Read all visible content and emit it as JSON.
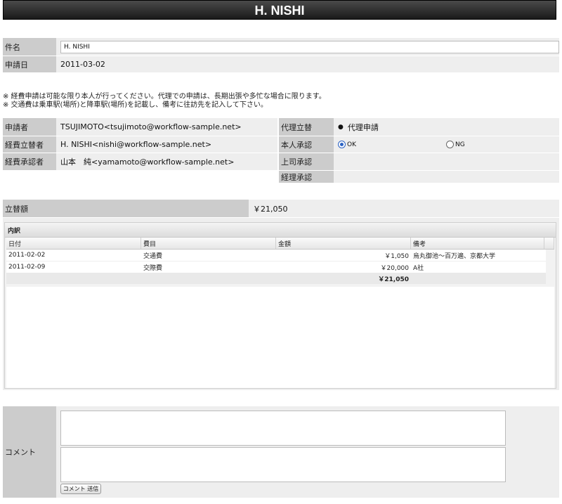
{
  "page": {
    "title": "H. NISHI"
  },
  "form": {
    "subject_label": "件名",
    "subject_value": "H. NISHI",
    "date_label": "申請日",
    "date_value": "2011-03-02"
  },
  "notes": [
    "※ 経費申請は可能な限り本人が行ってください。代理での申請は、長期出張や多忙な場合に限ります。",
    "※ 交通費は乗車駅(場所)と降車駅(場所)を記載し、備考に往訪先を記入して下さい。"
  ],
  "people": {
    "applicant_label": "申請者",
    "applicant_value": "TSUJIMOTO<tsujimoto@workflow-sample.net>",
    "payer_label": "経費立替者",
    "payer_value": "H. NISHI<nishi@workflow-sample.net>",
    "approver_label": "経費承認者",
    "approver_value": "山本　純<yamamoto@workflow-sample.net>",
    "proxy_label": "代理立替",
    "proxy_value": "代理申請",
    "self_approval_label": "本人承認",
    "self_approval_ok": "OK",
    "self_approval_ng": "NG",
    "boss_approval_label": "上司承認",
    "accounting_approval_label": "経理承認"
  },
  "amount": {
    "label": "立替額",
    "value": "￥21,050"
  },
  "breakdown": {
    "title": "内訳",
    "columns": [
      "日付",
      "費目",
      "金額",
      "備考"
    ],
    "rows": [
      {
        "date": "2011-02-02",
        "item": "交通費",
        "amount": "￥1,050",
        "note": "烏丸御池〜百万遍、京都大学"
      },
      {
        "date": "2011-02-09",
        "item": "交際費",
        "amount": "￥20,000",
        "note": "A社"
      }
    ],
    "total": "￥21,050"
  },
  "comment": {
    "label": "コメント",
    "button_label": "コメント 送信"
  }
}
